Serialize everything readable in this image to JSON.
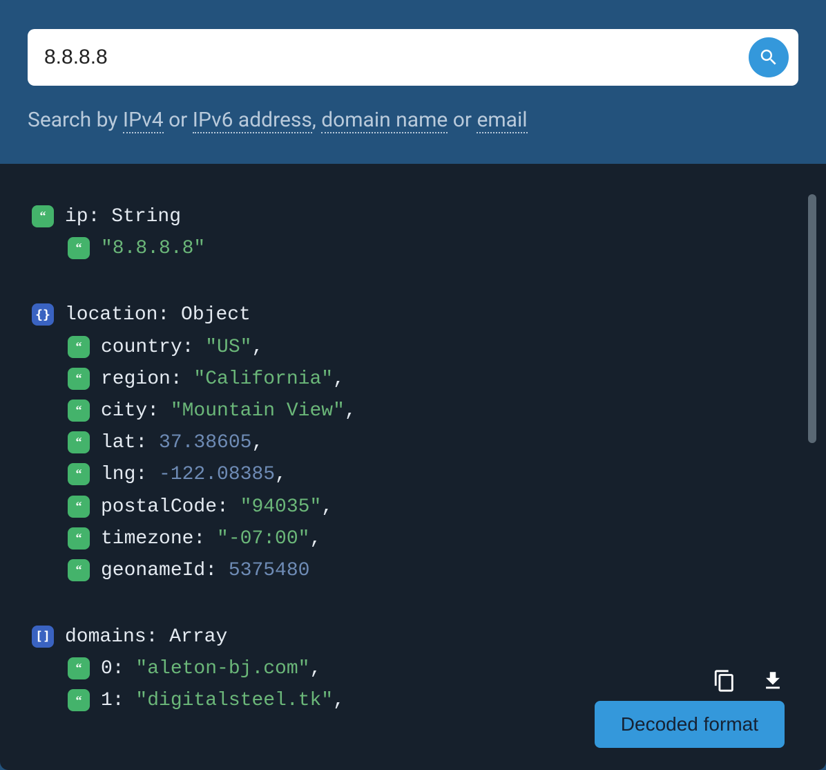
{
  "search": {
    "value": "8.8.8.8",
    "hint_prefix": "Search by ",
    "hint_links": {
      "ipv4": "IPv4",
      "ipv6": "IPv6 address",
      "domain": "domain name",
      "email": "email"
    },
    "hint_joins": {
      "or1": " or ",
      "comma": ", ",
      "or2": " or "
    }
  },
  "tree": {
    "ip": {
      "key": "ip",
      "type": "String",
      "value": "\"8.8.8.8\""
    },
    "location": {
      "key": "location",
      "type": "Object",
      "props": [
        {
          "key": "country",
          "valtype": "string",
          "value": "\"US\""
        },
        {
          "key": "region",
          "valtype": "string",
          "value": "\"California\""
        },
        {
          "key": "city",
          "valtype": "string",
          "value": "\"Mountain View\""
        },
        {
          "key": "lat",
          "valtype": "number",
          "value": "37.38605"
        },
        {
          "key": "lng",
          "valtype": "number",
          "value": "-122.08385"
        },
        {
          "key": "postalCode",
          "valtype": "string",
          "value": "\"94035\""
        },
        {
          "key": "timezone",
          "valtype": "string",
          "value": "\"-07:00\""
        },
        {
          "key": "geonameId",
          "valtype": "number",
          "value": "5375480"
        }
      ]
    },
    "domains": {
      "key": "domains",
      "type": "Array",
      "items": [
        {
          "idx": "0",
          "value": "\"aleton-bj.com\""
        },
        {
          "idx": "1",
          "value": "\"digitalsteel.tk\""
        }
      ]
    }
  },
  "buttons": {
    "decoded": "Decoded format"
  }
}
